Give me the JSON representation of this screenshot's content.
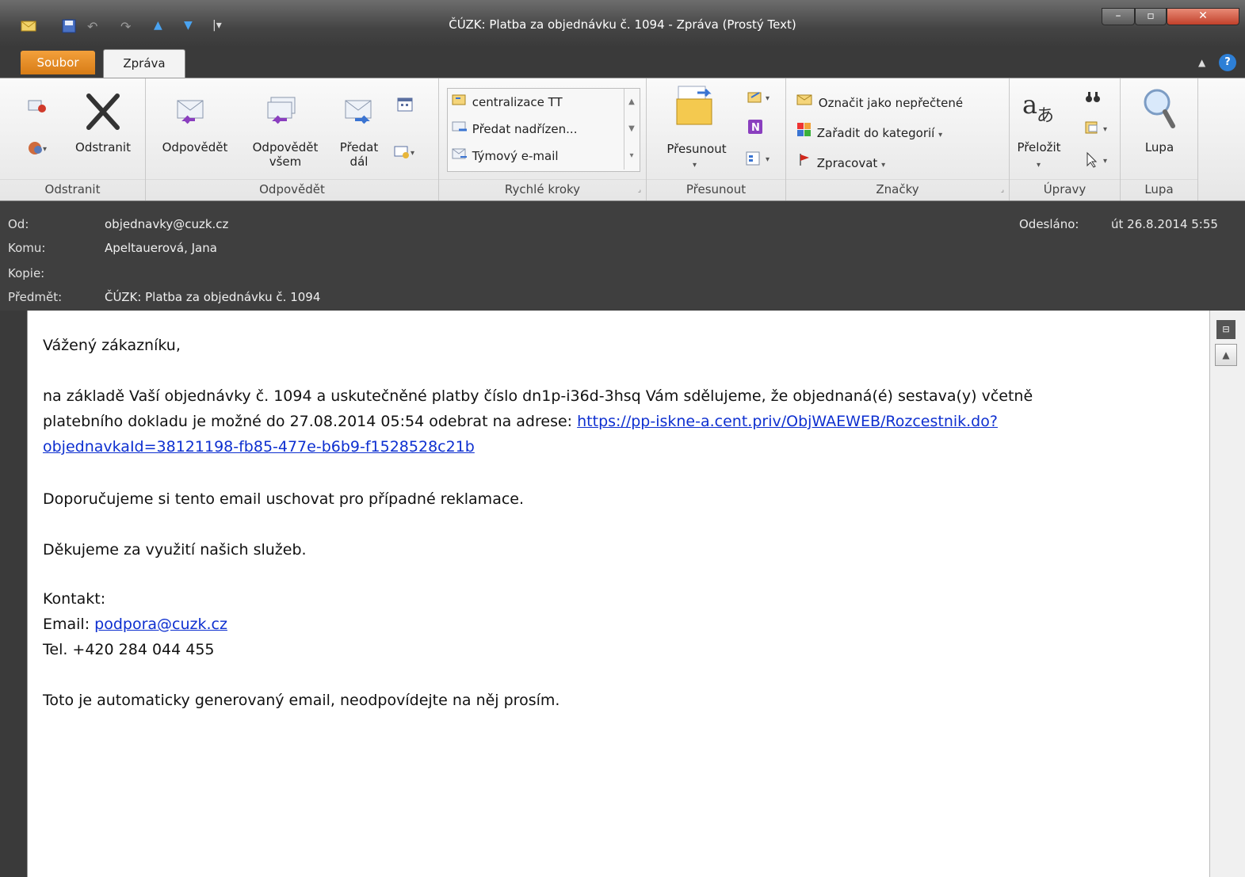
{
  "window": {
    "title": "ČÚZK: Platba za objednávku č. 1094  -  Zpráva (Prostý Text)"
  },
  "tabs": [
    {
      "label": "Soubor"
    },
    {
      "label": "Zpráva"
    }
  ],
  "ribbon": {
    "delete_group": {
      "label": "Odstranit",
      "delete_button": "Odstranit"
    },
    "respond_group": {
      "label": "Odpovědět",
      "reply": "Odpovědět",
      "reply_all_l1": "Odpovědět",
      "reply_all_l2": "všem",
      "forward_l1": "Předat",
      "forward_l2": "dál"
    },
    "quicksteps_group": {
      "label": "Rychlé kroky",
      "items": [
        "centralizace TT",
        "Předat nadřízen...",
        "Týmový e-mail"
      ]
    },
    "move_group": {
      "label": "Přesunout",
      "move_button": "Přesunout"
    },
    "tags_group": {
      "label": "Značky",
      "mark_unread": "Označit jako nepřečtené",
      "categorize": "Zařadit do kategorií",
      "follow_up": "Zpracovat"
    },
    "editing_group": {
      "label": "Úpravy",
      "translate": "Přeložit"
    },
    "zoom_group": {
      "label": "Lupa",
      "zoom_button": "Lupa"
    }
  },
  "header": {
    "from_label": "Od:",
    "from_value": "objednavky@cuzk.cz",
    "to_label": "Komu:",
    "to_value": "Apeltauerová, Jana",
    "cc_label": "Kopie:",
    "subject_label": "Předmět:",
    "subject_value": "ČÚZK: Platba za objednávku č. 1094",
    "sent_label": "Odesláno:",
    "sent_value": "út 26.8.2014 5:55"
  },
  "message": {
    "greeting": "Vážený zákazníku,",
    "p1_line1": "na základě Vaší objednávky č. 1094 a uskutečněné platby číslo dn1p-i36d-3hsq Vám sdělujeme, že objednaná(é) sestava(y) včetně",
    "p1_line2_prefix": "platebního dokladu je možné do 27.08.2014 05:54 odebrat na adrese: ",
    "link_line1": "https://pp-iskne-a.cent.priv/ObjWAEWEB/Rozcestnik.do?",
    "link_line2": "objednavkaId=38121198-fb85-477e-b6b9-f1528528c21b",
    "p2": "Doporučujeme si tento email uschovat pro případné reklamace.",
    "p3": "Děkujeme za využití našich služeb.",
    "contact_heading": "Kontakt:",
    "email_prefix": "Email: ",
    "email_link": "podpora@cuzk.cz",
    "phone": "Tel. +420 284 044 455",
    "footer": "Toto je automaticky generovaný email, neodpovídejte na něj prosím."
  }
}
